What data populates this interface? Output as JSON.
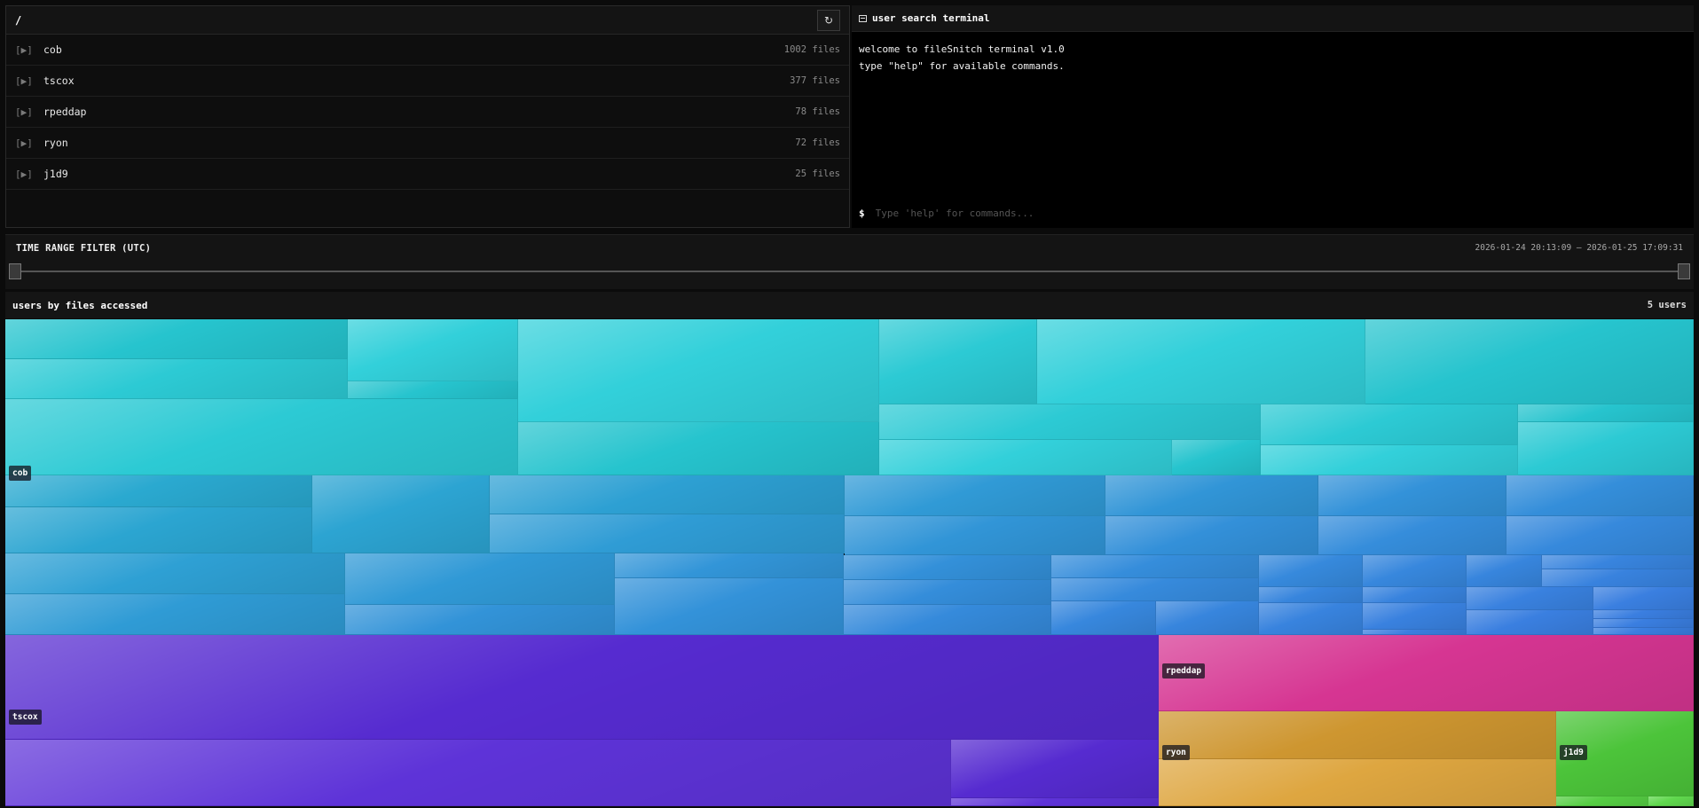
{
  "file_tree": {
    "path": "/",
    "refresh_icon": "↻",
    "toggle_text": "[▶]",
    "items": [
      {
        "name": "cob",
        "count": "1002 files"
      },
      {
        "name": "tscox",
        "count": "377 files"
      },
      {
        "name": "rpeddap",
        "count": "78 files"
      },
      {
        "name": "ryon",
        "count": "72 files"
      },
      {
        "name": "j1d9",
        "count": "25 files"
      }
    ]
  },
  "terminal": {
    "title": "user search terminal",
    "icon": "terminal-icon",
    "output": "welcome to fileSnitch terminal v1.0\ntype \"help\" for available commands.",
    "prompt": "$",
    "placeholder": "Type 'help' for commands..."
  },
  "time_filter": {
    "label": "TIME RANGE FILTER (UTC)",
    "range_text": "2026-01-24 20:13:09 – 2026-01-25 17:09:31"
  },
  "treemap": {
    "title": "users by files accessed",
    "count_label": "5 users",
    "users": [
      {
        "name": "cob",
        "color": "#2ac8d2"
      },
      {
        "name": "tscox",
        "color": "#5a2fd4"
      },
      {
        "name": "rpeddap",
        "color": "#d63592"
      },
      {
        "name": "ryon",
        "color": "#d8a03a"
      },
      {
        "name": "j1d9",
        "color": "#4cc43a"
      }
    ]
  }
}
